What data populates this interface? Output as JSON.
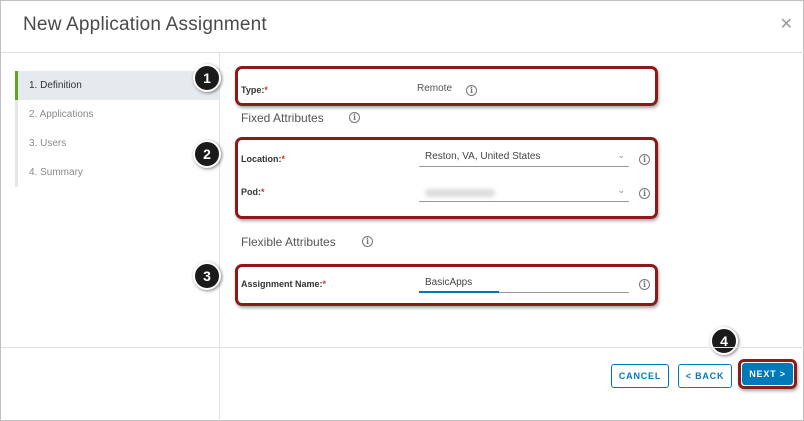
{
  "dialog": {
    "title": "New Application Assignment",
    "close_icon": "close-icon"
  },
  "sidebar": {
    "steps": [
      {
        "label": "1. Definition",
        "active": true
      },
      {
        "label": "2. Applications",
        "active": false
      },
      {
        "label": "3. Users",
        "active": false
      },
      {
        "label": "4. Summary",
        "active": false
      }
    ]
  },
  "form": {
    "type": {
      "label": "Type:",
      "required_mark": "*",
      "value": "Remote"
    },
    "fixed_attributes": {
      "heading": "Fixed Attributes"
    },
    "location": {
      "label": "Location:",
      "required_mark": "*",
      "value": "Reston, VA, United States"
    },
    "pod": {
      "label": "Pod:",
      "required_mark": "*",
      "value": ""
    },
    "flexible_attributes": {
      "heading": "Flexible Attributes"
    },
    "assignment_name": {
      "label": "Assignment Name:",
      "required_mark": "*",
      "value": "BasicApps"
    },
    "info_glyph": "i",
    "chevron_glyph": "⌄"
  },
  "callouts": [
    "1",
    "2",
    "3",
    "4"
  ],
  "footer": {
    "cancel_label": "CANCEL",
    "back_label": "< BACK",
    "next_label": "NEXT >"
  },
  "colors": {
    "accent": "#0079b8",
    "active_step_bar": "#62a420",
    "highlight_border": "#8b1a1a",
    "required": "#d0352b"
  }
}
